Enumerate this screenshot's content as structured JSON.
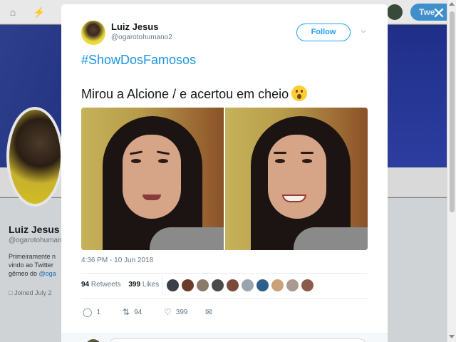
{
  "background_profile": {
    "name": "Luiz Jesus",
    "handle": "@ogarotohumano",
    "bio_lines": [
      "Primeiramente n",
      "vindo ao Twitter",
      "gêmeo do "
    ],
    "bio_link": "@oga",
    "joined": "Joined July 2",
    "tweet_button": "Twe"
  },
  "tweet": {
    "author_name": "Luiz Jesus",
    "author_handle": "@ogarotohumano2",
    "follow_label": "Follow",
    "hashtag": "#ShowDosFamosos",
    "text": "Mirou a Alcione / e acertou em cheio",
    "timestamp": "4:36 PM - 10 Jun 2018",
    "retweets_count": "94",
    "retweets_label": "Retweets",
    "likes_count": "399",
    "likes_label": "Likes",
    "actions": {
      "reply_count": "1",
      "retweet_count": "94",
      "like_count": "399"
    },
    "likers_colors": [
      "#3a3f47",
      "#6b3a2a",
      "#8a7a6a",
      "#4a4a4a",
      "#7a4a3a",
      "#9aa4ad",
      "#2c5f8a",
      "#c9a27a",
      "#a89a90",
      "#8a5a4a"
    ]
  },
  "colors": {
    "accent": "#1da1f2",
    "link": "#1b95e0",
    "text_secondary": "#657786"
  },
  "icons": {
    "close": "close-icon",
    "scroll": "scrollbar",
    "reply": "reply-icon",
    "retweet": "retweet-icon",
    "like": "heart-icon",
    "dm": "envelope-icon",
    "caret": "chevron-down-icon"
  }
}
